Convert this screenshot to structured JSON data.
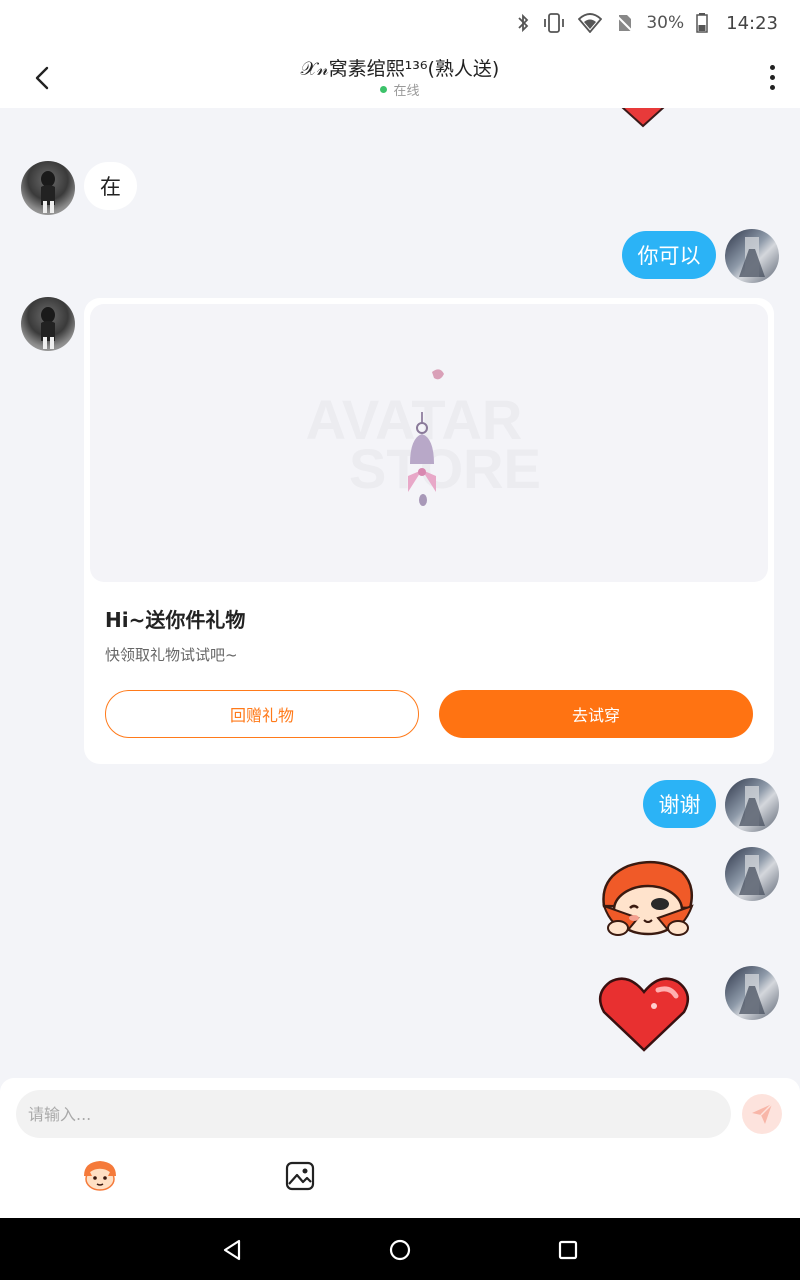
{
  "status_bar": {
    "battery_percent": "30%",
    "time": "14:23"
  },
  "header": {
    "title": "𝒳𝓃窝素绾熙¹³⁶(熟人送)",
    "status": "在线"
  },
  "messages": [
    {
      "side": "left",
      "text": "在"
    },
    {
      "side": "right",
      "text": "你可以"
    },
    {
      "side": "right",
      "text": "谢谢"
    }
  ],
  "gift_card": {
    "watermark_top": "AVATAR",
    "watermark_bottom": "STORE",
    "title": "Hi~送你件礼物",
    "description": "快领取礼物试试吧~",
    "return_gift_label": "回赠礼物",
    "try_on_label": "去试穿"
  },
  "input": {
    "placeholder": "请输入..."
  },
  "colors": {
    "accent_orange": "#ff7312",
    "bubble_blue": "#2bb3f6",
    "online_green": "#3cc26a"
  },
  "icons": {
    "back": "back-arrow-icon",
    "more": "more-vertical-icon",
    "send": "send-icon",
    "emoji": "emoji-icon",
    "image": "image-icon"
  }
}
